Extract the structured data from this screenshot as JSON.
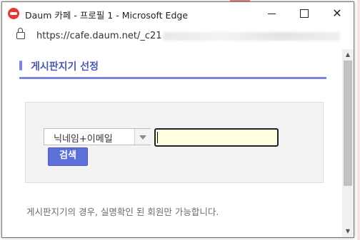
{
  "window": {
    "title": "Daum 카페 - 프로필 1 - Microsoft Edge",
    "url": "https://cafe.daum.net/_c21"
  },
  "icons": {
    "app": "daum-logo-icon",
    "lock": "lock-icon",
    "minimize": "minimize-icon",
    "maximize": "maximize-icon",
    "close": "close-icon",
    "dropdown": "chevron-down-icon"
  },
  "page": {
    "heading": "게시판지기 선정",
    "search": {
      "select_value": "닉네임+이메일",
      "input_value": "",
      "button_label": "검색"
    },
    "notice": "게시판지기의 경우, 실명확인 된 회원만 가능합니다."
  },
  "colors": {
    "accent": "#7b84e6",
    "heading_text": "#4a5aa8",
    "button": "#5d6fd8",
    "input_bg": "#fffee0"
  }
}
